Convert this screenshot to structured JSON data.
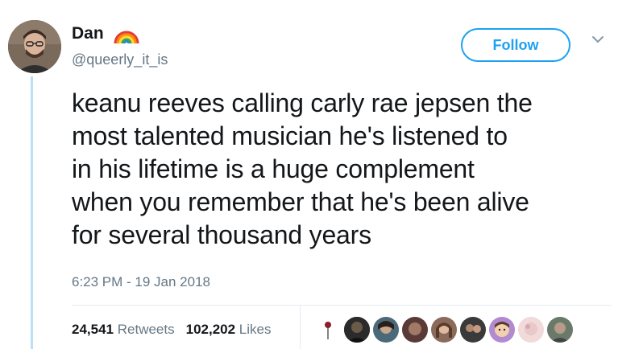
{
  "author": {
    "display_name": "Dan",
    "handle": "@queerly_it_is",
    "name_emoji": "rainbow-icon"
  },
  "actions": {
    "follow_label": "Follow",
    "menu_icon": "chevron-down-icon"
  },
  "tweet": {
    "lines": [
      "keanu reeves calling carly rae jepsen the",
      "most talented musician he's listened to",
      "in his lifetime is a huge complement",
      "when you remember that he's been alive",
      "for several thousand years"
    ],
    "timestamp": "6:23 PM - 19 Jan 2018"
  },
  "stats": {
    "retweets_count": "24,541",
    "retweets_label": "Retweets",
    "likes_count": "102,202",
    "likes_label": "Likes"
  },
  "colors": {
    "accent": "#1da1f2",
    "secondary_text": "#657786",
    "thread_line": "#b9e0f5"
  },
  "liker_avatars": [
    {
      "name": "liker-avatar-1",
      "color": "#ffffff"
    },
    {
      "name": "liker-avatar-2",
      "color": "#2b2b2b"
    },
    {
      "name": "liker-avatar-3",
      "color": "#4a6a7a"
    },
    {
      "name": "liker-avatar-4",
      "color": "#5a3a36"
    },
    {
      "name": "liker-avatar-5",
      "color": "#8a6a5a"
    },
    {
      "name": "liker-avatar-6",
      "color": "#3a3a3a"
    },
    {
      "name": "liker-avatar-7",
      "color": "#b28a6a"
    },
    {
      "name": "liker-avatar-8",
      "color": "#e8c8c8"
    },
    {
      "name": "liker-avatar-9",
      "color": "#6a7a6a"
    }
  ]
}
